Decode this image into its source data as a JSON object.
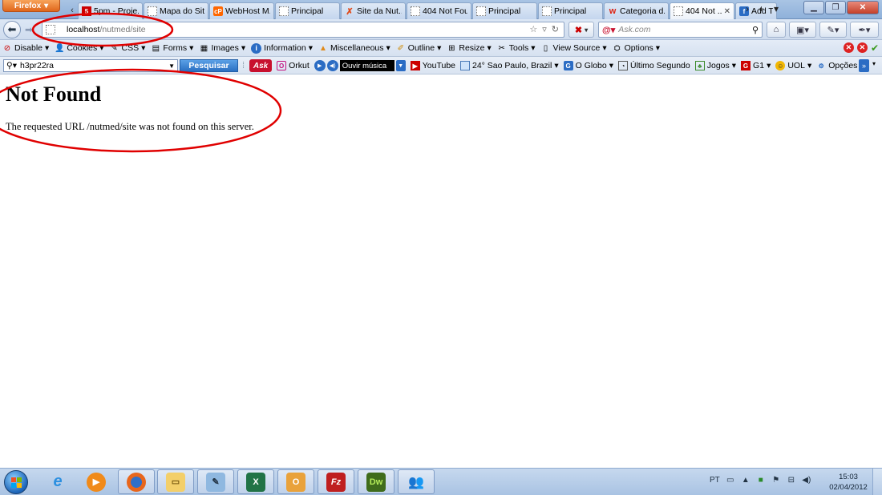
{
  "browser": {
    "menu_label": "Firefox",
    "tabs": [
      {
        "label": "5pm - Proje..."
      },
      {
        "label": "Mapa do Site"
      },
      {
        "label": "WebHost M..."
      },
      {
        "label": "Principal"
      },
      {
        "label": "Site da Nut..."
      },
      {
        "label": "404 Not Fou..."
      },
      {
        "label": "Principal"
      },
      {
        "label": "Principal"
      },
      {
        "label": "Categoria d..."
      },
      {
        "label": "404 Not ..."
      },
      {
        "label": "Add T"
      }
    ],
    "url": {
      "host": "localhost",
      "path": "/nutmed/site"
    },
    "search_placeholder": "Ask.com"
  },
  "devbar": {
    "items": [
      {
        "label": "Disable"
      },
      {
        "label": "Cookies"
      },
      {
        "label": "CSS"
      },
      {
        "label": "Forms"
      },
      {
        "label": "Images"
      },
      {
        "label": "Information"
      },
      {
        "label": "Miscellaneous"
      },
      {
        "label": "Outline"
      },
      {
        "label": "Resize"
      },
      {
        "label": "Tools"
      },
      {
        "label": "View Source"
      },
      {
        "label": "Options"
      }
    ]
  },
  "askbar": {
    "query": "h3pr22ra",
    "search_button": "Pesquisar",
    "logo": "Ask",
    "orkut": "Orkut",
    "music_label": "Ouvir música",
    "items": {
      "youtube": "YouTube",
      "weather": "24° Sao Paulo, Brazil",
      "oglobo": "O Globo",
      "ultimo": "Último Segundo",
      "jogos": "Jogos",
      "g1": "G1",
      "uol": "UOL",
      "opcoes": "Opções"
    }
  },
  "page": {
    "title": "Not Found",
    "message": "The requested URL /nutmed/site was not found on this server."
  },
  "annotation_color": "#e00000",
  "taskbar": {
    "lang": "PT",
    "time": "15:03",
    "date": "02/04/2012",
    "apps": [
      "Internet Explorer",
      "Windows Media Player",
      "Firefox",
      "Windows Explorer",
      "Notepad",
      "Excel",
      "Outlook",
      "FileZilla",
      "Dreamweaver",
      "Messenger"
    ]
  }
}
